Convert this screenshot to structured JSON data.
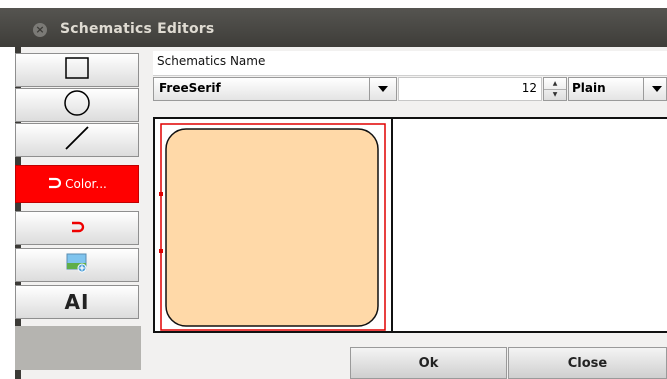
{
  "window": {
    "title": "Schematics Editors"
  },
  "tools": [
    {
      "name": "rectangle-tool",
      "icon": "rectangle-icon"
    },
    {
      "name": "circle-tool",
      "icon": "circle-icon"
    },
    {
      "name": "line-tool",
      "icon": "line-icon"
    },
    {
      "name": "color-tool",
      "icon": "magnet-icon",
      "label": "Color..."
    },
    {
      "name": "magnet-tool",
      "icon": "magnet-icon"
    },
    {
      "name": "image-tool",
      "icon": "add-image-icon"
    },
    {
      "name": "text-tool",
      "icon": "text-icon",
      "label": "AI"
    }
  ],
  "form": {
    "name_value": "Schematics Name",
    "font_family": "FreeSerif",
    "font_size": "12",
    "font_style": "Plain"
  },
  "shape": {
    "fill": "#ffd9a8",
    "selection_color": "#e00000"
  },
  "buttons": {
    "ok": "Ok",
    "close": "Close"
  }
}
